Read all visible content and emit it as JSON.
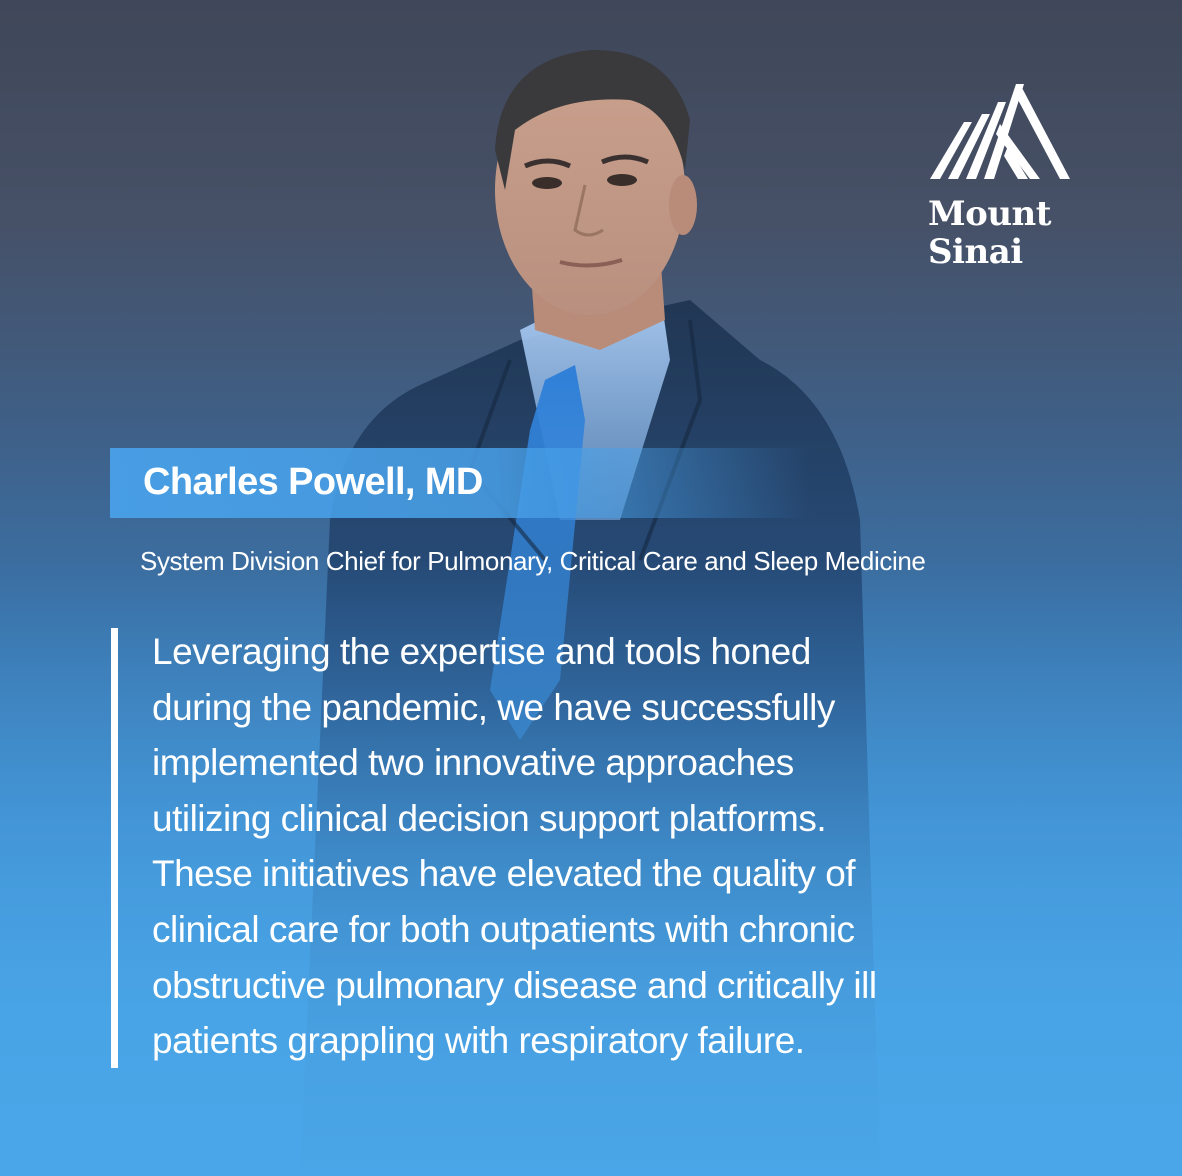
{
  "logo": {
    "line1": "Mount",
    "line2": "Sinai",
    "icon": "mountain-peaks-icon"
  },
  "person": {
    "name": "Charles Powell, MD",
    "title": "System Division Chief for Pulmonary, Critical Care and Sleep Medicine"
  },
  "quote": {
    "lines": [
      "Leveraging the expertise and tools honed",
      "during the pandemic, we have successfully",
      "implemented two innovative approaches",
      "utilizing clinical decision support platforms.",
      "These initiatives have elevated the quality of",
      "clinical care for both outpatients with chronic",
      "obstructive pulmonary disease and critically ill",
      "patients grappling with respiratory failure."
    ]
  },
  "colors": {
    "background_top": "#3f4759",
    "background_bottom": "#4aa6e8",
    "name_band": "#48a0e8",
    "text": "#ffffff"
  }
}
